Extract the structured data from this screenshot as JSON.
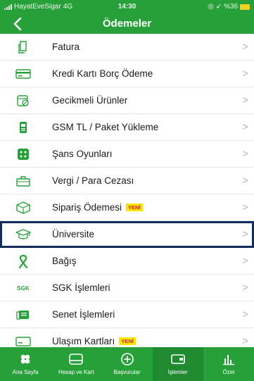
{
  "status_bar": {
    "carrier": "HayatEveSigar",
    "network": "4G",
    "time": "14:30",
    "battery": "%36"
  },
  "header": {
    "title": "Ödemeler"
  },
  "menu": {
    "items": [
      {
        "label": "Fatura",
        "icon": "document-icon"
      },
      {
        "label": "Kredi Kartı Borç Ödeme",
        "icon": "credit-card-icon"
      },
      {
        "label": "Gecikmeli Ürünler",
        "icon": "delayed-items-icon"
      },
      {
        "label": "GSM TL / Paket Yükleme",
        "icon": "mobile-phone-icon"
      },
      {
        "label": "Şans Oyunları",
        "icon": "dice-icon"
      },
      {
        "label": "Vergi / Para Cezası",
        "icon": "briefcase-icon"
      },
      {
        "label": "Sipariş Ödemesi",
        "icon": "package-icon",
        "badge": "YENİ"
      },
      {
        "label": "Üniversite",
        "icon": "graduation-cap-icon",
        "highlighted": true
      },
      {
        "label": "Bağış",
        "icon": "ribbon-icon"
      },
      {
        "label": "SGK İşlemleri",
        "icon": "sgk-logo-icon",
        "icon_text": "SGK"
      },
      {
        "label": "Senet İşlemleri",
        "icon": "promissory-note-icon"
      },
      {
        "label": "Ulaşım Kartları",
        "icon": "transport-card-icon",
        "badge": "YENİ"
      }
    ]
  },
  "tab_bar": {
    "active": "İşlemler",
    "tabs": [
      {
        "label": "Ana Sayfa",
        "icon": "clover-icon"
      },
      {
        "label": "Hesap ve Kart",
        "icon": "wallet-icon"
      },
      {
        "label": "Başvurular",
        "icon": "plus-circle-icon"
      },
      {
        "label": "İşlemler",
        "icon": "card-transactions-icon"
      },
      {
        "label": "Özet",
        "icon": "bar-chart-icon"
      }
    ]
  },
  "colors": {
    "brand_green": "#27a03a",
    "tab_active": "#1f8a30",
    "highlight_border": "#142c5c",
    "badge_bg": "#f6e600",
    "badge_text": "#d4262e"
  }
}
